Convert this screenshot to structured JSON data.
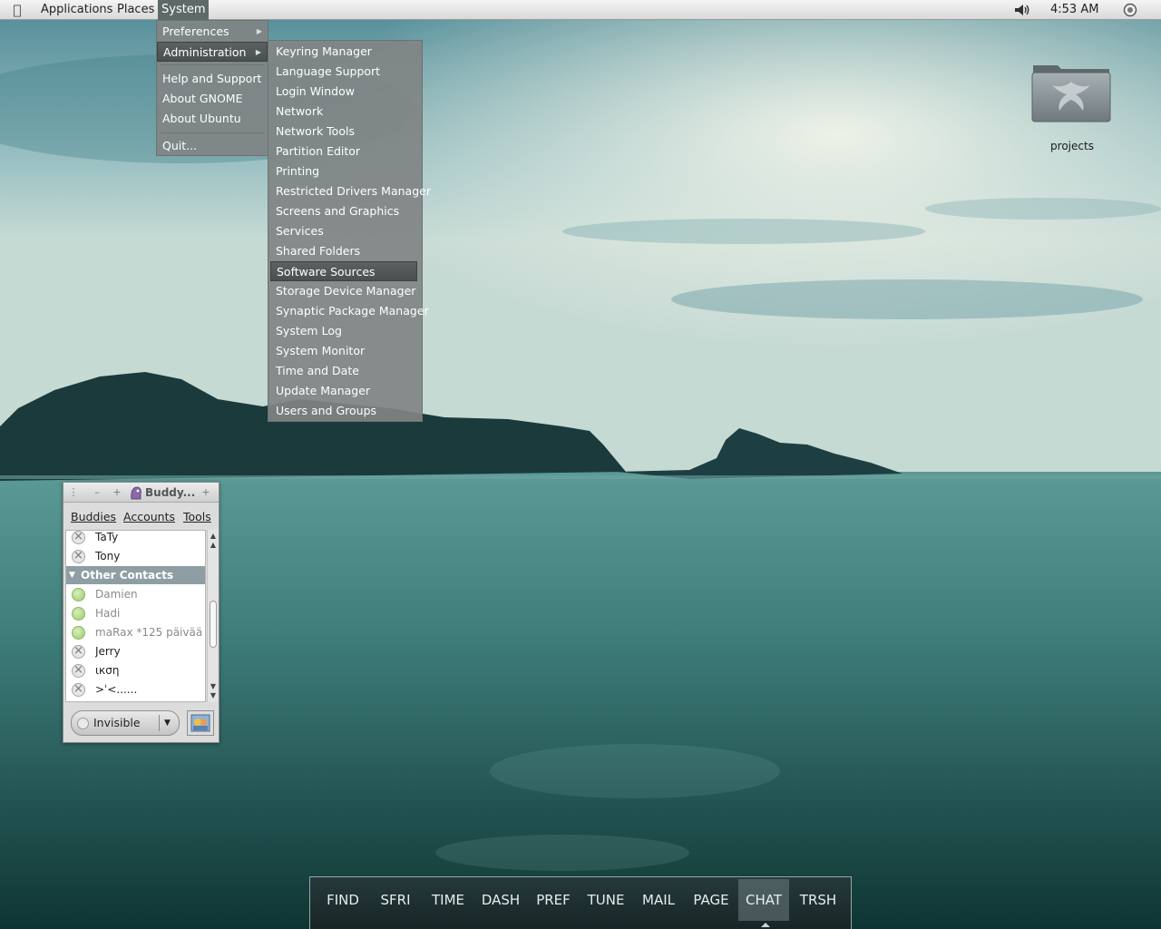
{
  "top_panel": {
    "menus": [
      "Applications",
      "Places",
      "System"
    ],
    "active_menu": "System",
    "clock": "4:53 AM",
    "icons": [
      "apple-logo-icon",
      "volume-icon",
      "session-icon"
    ]
  },
  "system_menu": {
    "items": [
      "Preferences",
      "Administration",
      "Help and Support",
      "About GNOME",
      "About Ubuntu",
      "Quit..."
    ],
    "highlighted": "Administration"
  },
  "admin_menu": {
    "items": [
      "Keyring Manager",
      "Language Support",
      "Login Window",
      "Network",
      "Network Tools",
      "Partition Editor",
      "Printing",
      "Restricted Drivers Manager",
      "Screens and Graphics",
      "Services",
      "Shared Folders",
      "Software Sources",
      "Storage Device Manager",
      "Synaptic Package Manager",
      "System Log",
      "System Monitor",
      "Time and Date",
      "Update Manager",
      "Users and Groups"
    ],
    "highlighted": "Software Sources"
  },
  "desktop": {
    "icons": [
      {
        "label": "projects",
        "icon": "folder-icon"
      }
    ]
  },
  "buddy_window": {
    "title": "Buddy...",
    "menus": [
      "Buddies",
      "Accounts",
      "Tools"
    ],
    "rows": [
      {
        "type": "buddy",
        "name": "TaTy",
        "status": "offline"
      },
      {
        "type": "buddy",
        "name": "Tony",
        "status": "offline"
      },
      {
        "type": "group",
        "name": "Other Contacts",
        "expanded": true
      },
      {
        "type": "buddy",
        "name": "Damien",
        "status": "available-idle"
      },
      {
        "type": "buddy",
        "name": "Hadi",
        "status": "available-idle"
      },
      {
        "type": "buddy",
        "name": "maRax *125 päivää...",
        "status": "available-idle"
      },
      {
        "type": "buddy",
        "name": "Jerry",
        "status": "offline"
      },
      {
        "type": "buddy",
        "name": "ιкση",
        "status": "offline"
      },
      {
        "type": "buddy",
        "name": ">ˈ<......",
        "status": "offline"
      }
    ],
    "status_selector": "Invisible"
  },
  "dock": {
    "items": [
      "FIND",
      "SFRI",
      "TIME",
      "DASH",
      "PREF",
      "TUNE",
      "MAIL",
      "PAGE",
      "CHAT",
      "TRSH"
    ],
    "active": "CHAT"
  },
  "colors": {
    "menu_bg": "#808484",
    "menu_highlight": "#4f5555",
    "panel_bg": "#e6e6e6",
    "dock_bg": "#22302f",
    "group_header": "#8e9ea4"
  }
}
